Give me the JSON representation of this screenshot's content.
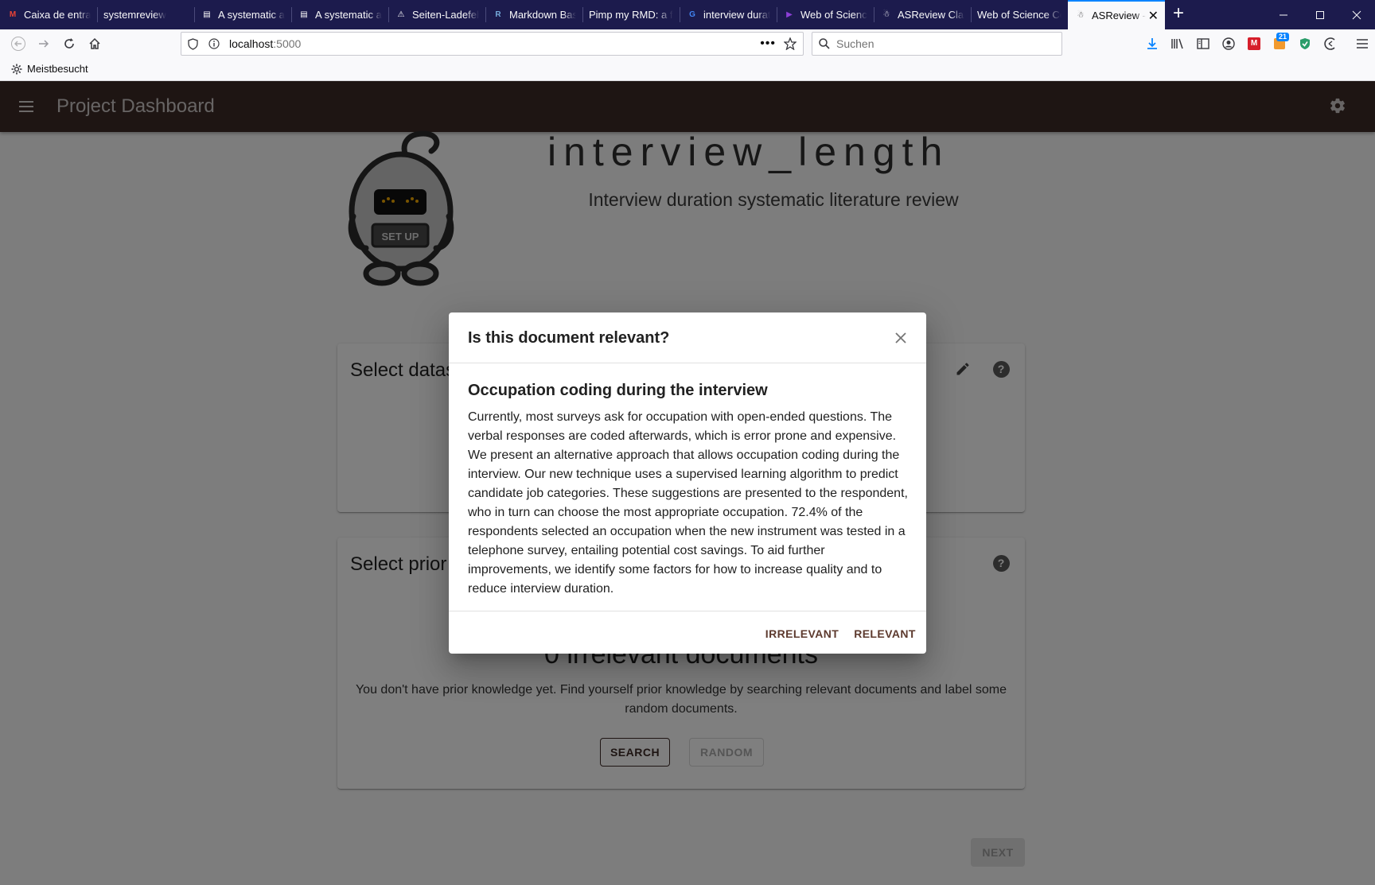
{
  "browser": {
    "tabs": [
      {
        "label": "Caixa de entrad",
        "favicon": "gmail-icon",
        "favicon_glyph": "M",
        "favicon_color": "#ea4335"
      },
      {
        "label": "systemreview",
        "favicon": "",
        "favicon_glyph": "",
        "favicon_color": ""
      },
      {
        "label": "A systematic ap",
        "favicon": "document-icon",
        "favicon_glyph": "▤",
        "favicon_color": "#ffffff"
      },
      {
        "label": "A systematic ap",
        "favicon": "document-icon",
        "favicon_glyph": "▤",
        "favicon_color": "#ffffff"
      },
      {
        "label": "Seiten-Ladefehl",
        "favicon": "warning-icon",
        "favicon_glyph": "⚠",
        "favicon_color": "#ffffff"
      },
      {
        "label": "Markdown Basi",
        "favicon": "r-icon",
        "favicon_glyph": "R",
        "favicon_color": "#75aadb"
      },
      {
        "label": "Pimp my RMD: a fe",
        "favicon": "",
        "favicon_glyph": "",
        "favicon_color": ""
      },
      {
        "label": "interview durat",
        "favicon": "google-icon",
        "favicon_glyph": "G",
        "favicon_color": "#4285f4"
      },
      {
        "label": "Web of Science",
        "favicon": "clarivate-icon",
        "favicon_glyph": "▶",
        "favicon_color": "#8c3fd6"
      },
      {
        "label": "ASReview Class",
        "favicon": "asreview-icon",
        "favicon_glyph": "☃",
        "favicon_color": "#ffffff"
      },
      {
        "label": "Web of Science Co",
        "favicon": "",
        "favicon_glyph": "",
        "favicon_color": ""
      },
      {
        "label": "ASReview -",
        "favicon": "asreview-icon",
        "favicon_glyph": "☃",
        "favicon_color": "#333333",
        "active": true
      }
    ],
    "new_tab_label": "+",
    "url_host": "localhost",
    "url_port": ":5000",
    "search_placeholder": "Suchen",
    "bookmark_label": "Meistbesucht",
    "downloads_badge": "21",
    "accent_color": "#0a84ff",
    "tabbar_color": "#1c1b4d"
  },
  "app": {
    "title": "Project Dashboard",
    "appbar_color": "#3d2b26",
    "robot_label": "SET UP",
    "project_name": "interview_length",
    "project_description": "Interview duration systematic literature review",
    "dataset_card_title": "Select dataset",
    "prior_card_title": "Select prior knowledge",
    "prior_count": "0 irrelevant documents",
    "prior_text": "You don't have prior knowledge yet. Find yourself prior knowledge by searching relevant documents and label some random documents.",
    "search_label": "SEARCH",
    "random_label": "RANDOM",
    "next_label": "NEXT"
  },
  "dialog": {
    "title": "Is this document relevant?",
    "document_title": "Occupation coding during the interview",
    "abstract": "Currently, most surveys ask for occupation with open-ended questions. The verbal responses are coded afterwards, which is error prone and expensive. We present an alternative approach that allows occupation coding during the interview. Our new technique uses a supervised learning algorithm to predict candidate job categories. These suggestions are presented to the respondent, who in turn can choose the most appropriate occupation. 72.4% of the respondents selected an occupation when the new instrument was tested in a telephone survey, entailing potential cost savings. To aid further improvements, we identify some factors for how to increase quality and to reduce interview duration.",
    "irrelevant_label": "IRRELEVANT",
    "relevant_label": "RELEVANT"
  }
}
